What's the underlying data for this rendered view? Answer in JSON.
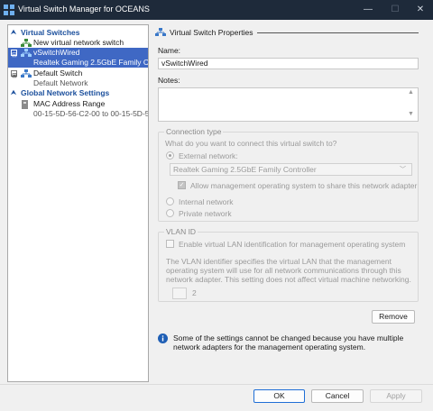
{
  "window": {
    "title": "Virtual Switch Manager for OCEANS",
    "controls": {
      "minimize": "—",
      "maximize": "☐",
      "close": "✕"
    }
  },
  "tree": {
    "virtual_switches_header": "Virtual Switches",
    "new_switch_label": "New virtual network switch",
    "switches": [
      {
        "name": "vSwitchWired",
        "detail": "Realtek Gaming 2.5GbE Family Con...",
        "selected": true,
        "expander": "⊟"
      },
      {
        "name": "Default Switch",
        "detail": "Default Network",
        "selected": false,
        "expander": "⊞"
      }
    ],
    "global_header": "Global Network Settings",
    "mac_range_label": "MAC Address Range",
    "mac_range_value": "00-15-5D-56-C2-00 to 00-15-5D-5...",
    "collapse_glyph": "⮝"
  },
  "properties": {
    "section_title": "Virtual Switch Properties",
    "name_label": "Name:",
    "name_value": "vSwitchWired",
    "notes_label": "Notes:",
    "notes_value": "",
    "connection_type": {
      "legend": "Connection type",
      "question": "What do you want to connect this virtual switch to?",
      "external_label": "External network:",
      "adapter_value": "Realtek Gaming 2.5GbE Family Controller",
      "allow_mgmt_label": "Allow management operating system to share this network adapter",
      "internal_label": "Internal network",
      "private_label": "Private network"
    },
    "vlan": {
      "legend": "VLAN ID",
      "enable_label": "Enable virtual LAN identification for management operating system",
      "description": "The VLAN identifier specifies the virtual LAN that the management operating system will use for all network communications through this network adapter. This setting does not affect virtual machine networking.",
      "vlan_id_value": "2"
    },
    "remove_label": "Remove",
    "info_text": "Some of the settings cannot be changed because you have multiple network adapters for the management operating system."
  },
  "buttons": {
    "ok": "OK",
    "cancel": "Cancel",
    "apply": "Apply"
  },
  "colors": {
    "titlebar": "#1e2a3a",
    "selection": "#3f68c4",
    "section_header": "#1b4f9c",
    "info_icon": "#1f5fb5"
  }
}
